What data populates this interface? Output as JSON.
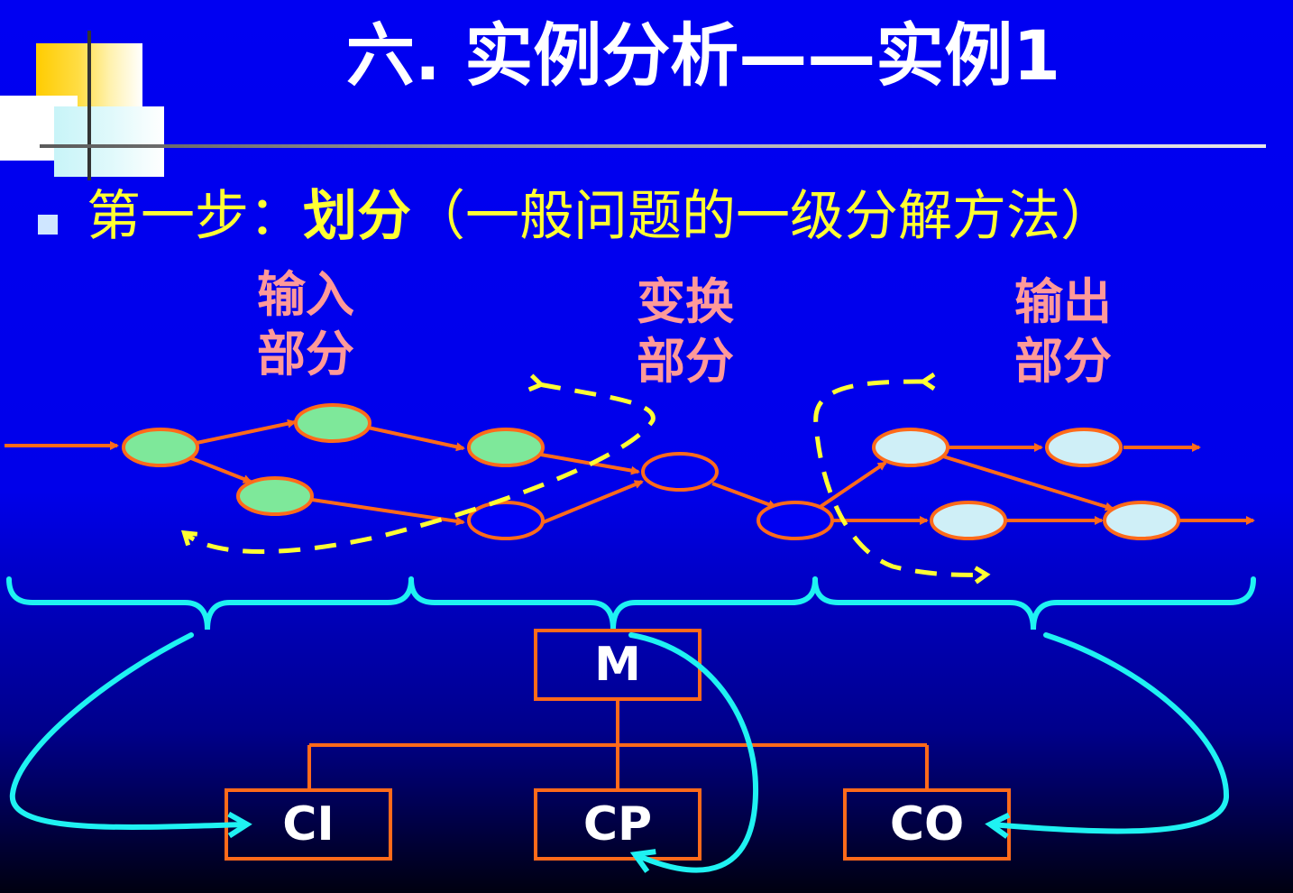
{
  "title": "六. 实例分析——实例1",
  "bullet": {
    "prefix": "第一步：",
    "bold": "划分",
    "suffix": "（一般问题的一级分解方法）"
  },
  "parts": {
    "input": {
      "line1": "输入",
      "line2": "部分"
    },
    "transform": {
      "line1": "变换",
      "line2": "部分"
    },
    "output": {
      "line1": "输出",
      "line2": "部分"
    }
  },
  "modules": {
    "main": "M",
    "input": "CI",
    "transform": "CP",
    "output": "CO"
  },
  "colors": {
    "background": "#0000f2",
    "title": "#ffffff",
    "bullet_text": "#ffff33",
    "part_label": "#ff9999",
    "flow_arrow": "#ff6a1a",
    "node_input": "#7ee89a",
    "node_output": "#cfeff7",
    "dashed_arrow": "#ffff33",
    "brace": "#1ff2f2"
  }
}
